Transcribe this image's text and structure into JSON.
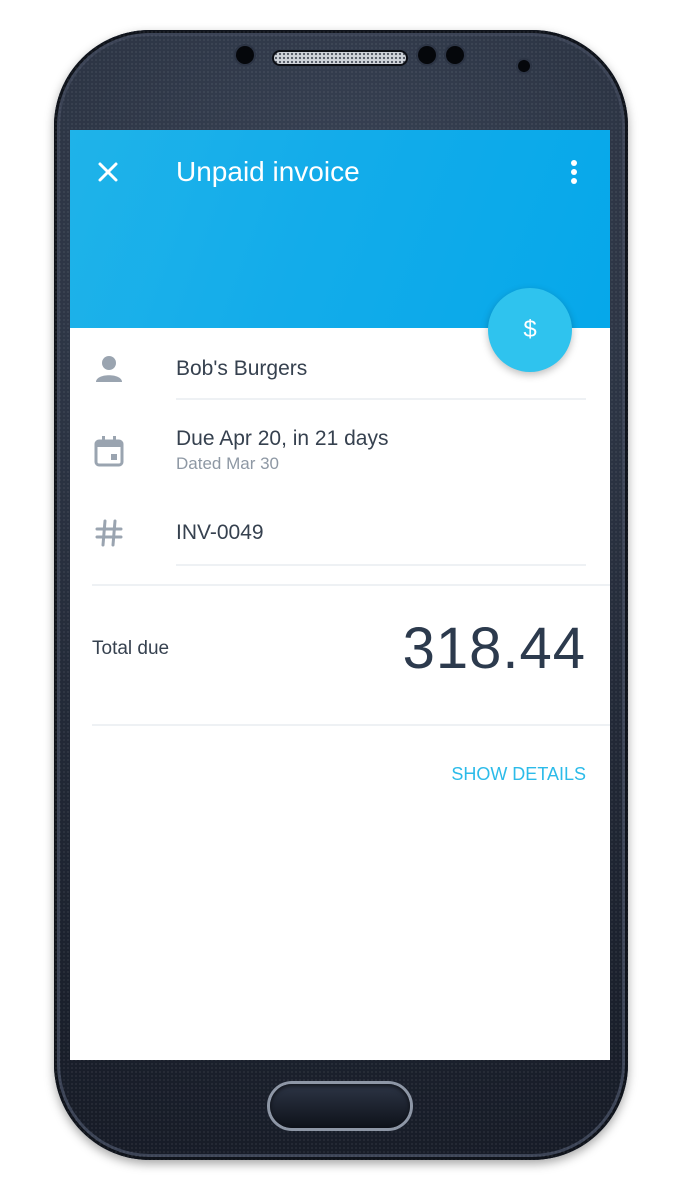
{
  "appbar": {
    "title": "Unpaid invoice",
    "color": "#13acea",
    "close_icon": "close-icon",
    "more_icon": "more-vert-icon"
  },
  "fab": {
    "label": "$",
    "icon": "dollar-icon",
    "color": "#2fc3ee"
  },
  "details": {
    "customer": {
      "icon": "person-icon",
      "name": "Bob's Burgers"
    },
    "due": {
      "icon": "calendar-icon",
      "primary": "Due Apr 20, in 21 days",
      "secondary": "Dated Mar 30"
    },
    "invoice_number": {
      "icon": "hash-icon",
      "value": "INV-0049"
    }
  },
  "total": {
    "label": "Total due",
    "amount": "318.44"
  },
  "actions": {
    "show_details": "SHOW DETAILS",
    "accent": "#2cbbe9"
  }
}
